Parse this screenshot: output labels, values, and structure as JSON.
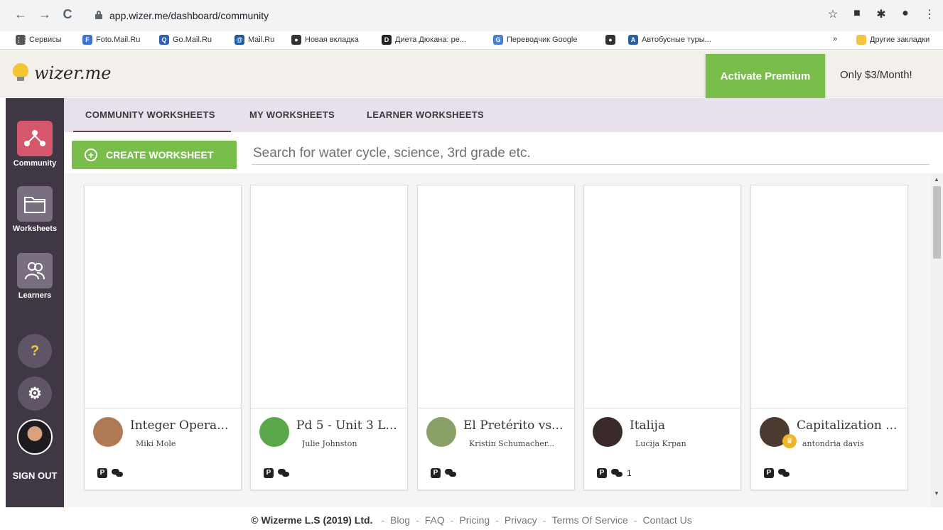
{
  "browser": {
    "url": "app.wizer.me/dashboard/community",
    "back_icon": "←",
    "forward_icon": "→",
    "reload_icon": "C",
    "bookmarks": [
      {
        "label": "Сервисы",
        "icon": "apps-icon",
        "color": "#555555",
        "glyph": "⋮⋮"
      },
      {
        "label": "Foto.Mail.Ru",
        "icon": "foto-mail-icon",
        "color": "#3b73d6",
        "glyph": "F"
      },
      {
        "label": "Go.Mail.Ru",
        "icon": "go-mail-icon",
        "color": "#2c5fb8",
        "glyph": "Q"
      },
      {
        "label": "Mail.Ru",
        "icon": "mail-ru-icon",
        "color": "#1a5ba8",
        "glyph": "@"
      },
      {
        "label": "Новая вкладка",
        "icon": "globe-icon",
        "color": "#333333",
        "glyph": "●"
      },
      {
        "label": "Диета Дюкана: ре...",
        "icon": "dukan-icon",
        "color": "#222222",
        "glyph": "D"
      },
      {
        "label": "Переводчик Google",
        "icon": "translate-icon",
        "color": "#4a7fd8",
        "glyph": "G"
      },
      {
        "label": "",
        "icon": "globe-icon",
        "color": "#333333",
        "glyph": "●"
      },
      {
        "label": "Автобусные туры...",
        "icon": "bus-tours-icon",
        "color": "#2a5ca8",
        "glyph": "A"
      }
    ],
    "more_bookmarks": "»",
    "other_bookmarks": "Другие закладки"
  },
  "header": {
    "logo": "wizer.me",
    "premium_button": "Activate Premium",
    "price": "Only $3/Month!"
  },
  "sidebar": {
    "items": [
      {
        "label": "Community",
        "icon": "community-icon"
      },
      {
        "label": "Worksheets",
        "icon": "folder-icon"
      },
      {
        "label": "Learners",
        "icon": "learners-icon"
      }
    ],
    "help_glyph": "?",
    "settings_glyph": "⚙",
    "sign_out": "SIGN OUT"
  },
  "tabs": [
    {
      "label": "COMMUNITY WORKSHEETS",
      "active": true
    },
    {
      "label": "MY WORKSHEETS",
      "active": false
    },
    {
      "label": "LEARNER WORKSHEETS",
      "active": false
    }
  ],
  "toolbar": {
    "create_label": "CREATE WORKSHEET",
    "search_placeholder": "Search for water cycle, science, 3rd grade etc."
  },
  "cards": [
    {
      "title": "Integer Opera...",
      "author": "Miki Mole",
      "comments": "",
      "avatar_color": "#b07a55"
    },
    {
      "title": "Pd 5 - Unit 3 L...",
      "author": "Julie Johnston",
      "comments": "",
      "avatar_color": "#5aa84a"
    },
    {
      "title": "El Pretérito vs...",
      "author": "Kristin Schumacher...",
      "comments": "",
      "avatar_color": "#8aa067"
    },
    {
      "title": "Italija",
      "author": "Lucija Krpan",
      "comments": "1",
      "avatar_color": "#3a2a2a"
    },
    {
      "title": "Capitalization ...",
      "author": "antondria davis",
      "comments": "",
      "avatar_color": "#4a3a30"
    }
  ],
  "footer": {
    "copyright": "© Wizerme L.S (2019) Ltd.",
    "links": [
      "Blog",
      "FAQ",
      "Pricing",
      "Privacy",
      "Terms Of Service",
      "Contact Us"
    ]
  }
}
